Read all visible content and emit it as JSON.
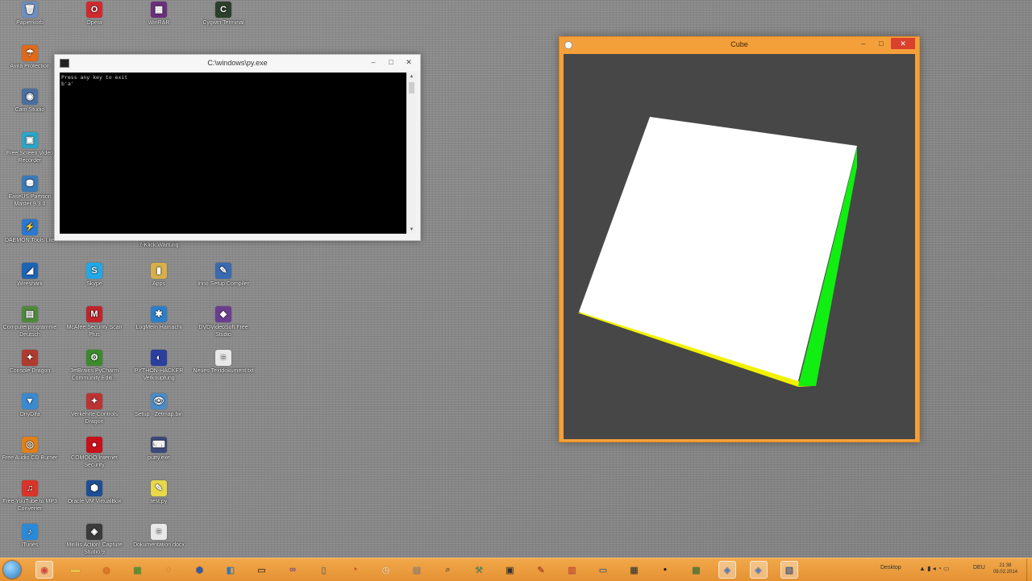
{
  "desktop": {
    "icons": [
      {
        "label": "Papierkorb",
        "color": "#6f8fbf",
        "glyph": "🗑"
      },
      {
        "label": "Opera",
        "color": "#d0292f",
        "glyph": "O"
      },
      {
        "label": "WinRAR",
        "color": "#6b2f7c",
        "glyph": "▦"
      },
      {
        "label": "Cygwin Terminal",
        "color": "#2c3e2c",
        "glyph": "C"
      },
      {
        "label": "Avira Protection",
        "color": "#e06a1a",
        "glyph": "☂"
      },
      {
        "label": "Cam Studio",
        "color": "#4a6f9f",
        "glyph": "◉"
      },
      {
        "label": "Free Screen Video Recorder",
        "color": "#2aa7c8",
        "glyph": "▣"
      },
      {
        "label": "EaseUS Partition Master 9.3.0",
        "color": "#3a7ab8",
        "glyph": "⛃"
      },
      {
        "label": "DAEMON Tools Lite",
        "color": "#2a78d0",
        "glyph": "⚡"
      },
      {
        "label": "Wireshark",
        "color": "#1c64b4",
        "glyph": "◢"
      },
      {
        "label": "Skype",
        "color": "#22a8e6",
        "glyph": "S"
      },
      {
        "label": "Apps",
        "color": "#d7b04a",
        "glyph": "▮"
      },
      {
        "label": "Inno Setup Compiler",
        "color": "#3a6ab0",
        "glyph": "✎"
      },
      {
        "label": "Computerprogramme Deutsch",
        "color": "#4d8a3a",
        "glyph": "▤"
      },
      {
        "label": "McAfee Security Scan Plus",
        "color": "#c0232b",
        "glyph": "M"
      },
      {
        "label": "LogMeIn Hamachi",
        "color": "#2c7fc9",
        "glyph": "✱"
      },
      {
        "label": "DVDVideoSoft Free Studio",
        "color": "#6a3d8f",
        "glyph": "◆"
      },
      {
        "label": "Console Dragon",
        "color": "#b03a2e",
        "glyph": "✦"
      },
      {
        "label": "JetBrains PyCharm Community Editi...",
        "color": "#3c8a2a",
        "glyph": "⚙"
      },
      {
        "label": "PYTHON-HACKER Verknüpfung",
        "color": "#2a3f9e",
        "glyph": "◐"
      },
      {
        "label": "Neues Textdokument.txt",
        "color": "#e8e8e8",
        "glyph": "≡"
      },
      {
        "label": "OnyDifa",
        "color": "#3a8ad0",
        "glyph": "▼"
      },
      {
        "label": "Verkehrte Controls Dragon",
        "color": "#b33",
        "glyph": "✦"
      },
      {
        "label": "Setup - Zetmap.bin",
        "color": "#4a8cc8",
        "glyph": "👁"
      },
      {
        "label": "Free Audio CD Burner",
        "color": "#e0801a",
        "glyph": "◎"
      },
      {
        "label": "COMODO Internet Security",
        "color": "#c8101a",
        "glyph": "●"
      },
      {
        "label": "putty.exe",
        "color": "#3a4a7a",
        "glyph": "⌨"
      },
      {
        "label": "Free YouTube to MP3 Converter",
        "color": "#d8342a",
        "glyph": "♫"
      },
      {
        "label": "Oracle VM VirtualBox",
        "color": "#1e4e94",
        "glyph": "⬢"
      },
      {
        "label": "test.py",
        "color": "#e8d84a",
        "glyph": "✎"
      },
      {
        "label": "iTunes",
        "color": "#2a8ad8",
        "glyph": "♪"
      },
      {
        "label": "Mirillis Action! Capture Studio 9",
        "color": "#3a3a3a",
        "glyph": "◈"
      },
      {
        "label": "Dokumentation.docx",
        "color": "#e8e8e8",
        "glyph": "≡"
      }
    ],
    "partial_labels": {
      "behind_console_3": "7-Klick Wartung"
    }
  },
  "console": {
    "title": "C:\\windows\\py.exe",
    "minimize": "–",
    "maximize": "□",
    "close": "✕",
    "lines": [
      "Press any key to exit",
      "b'a'"
    ]
  },
  "cube_window": {
    "title": "Cube",
    "minimize": "–",
    "maximize": "□",
    "close": "✕",
    "background": "#474747",
    "face_colors": {
      "front": "#ffffff",
      "side": "#11ee11",
      "bottom": "#f2f200"
    }
  },
  "taskbar": {
    "apps": [
      {
        "name": "chrome",
        "glyph": "◉",
        "active": true
      },
      {
        "name": "file-explorer",
        "glyph": "▬"
      },
      {
        "name": "firefox",
        "glyph": "◍"
      },
      {
        "name": "spreadsheet",
        "glyph": "▦"
      },
      {
        "name": "blender",
        "glyph": "◌"
      },
      {
        "name": "virtualbox",
        "glyph": "⬢"
      },
      {
        "name": "remote-desktop",
        "glyph": "◧"
      },
      {
        "name": "terminal",
        "glyph": "▭"
      },
      {
        "name": "visual-studio",
        "glyph": "∞"
      },
      {
        "name": "phone",
        "glyph": "▯"
      },
      {
        "name": "clock-app",
        "glyph": "◔"
      },
      {
        "name": "timer",
        "glyph": "◷"
      },
      {
        "name": "scanner",
        "glyph": "▤"
      },
      {
        "name": "search",
        "glyph": "⌕"
      },
      {
        "name": "tool",
        "glyph": "⚒"
      },
      {
        "name": "media",
        "glyph": "▣"
      },
      {
        "name": "editor",
        "glyph": "✎"
      },
      {
        "name": "notes",
        "glyph": "▥"
      },
      {
        "name": "monitor",
        "glyph": "▭"
      },
      {
        "name": "network",
        "glyph": "▦"
      },
      {
        "name": "console",
        "glyph": "▪"
      },
      {
        "name": "game",
        "glyph": "▩"
      },
      {
        "name": "python",
        "glyph": "◈",
        "active": true
      },
      {
        "name": "python-2",
        "glyph": "◈",
        "active": true
      },
      {
        "name": "image",
        "glyph": "▧",
        "active": true
      }
    ],
    "toolbar_label": "Desktop",
    "language": "DEU",
    "time": "21:38",
    "date": "09.02.2014"
  }
}
